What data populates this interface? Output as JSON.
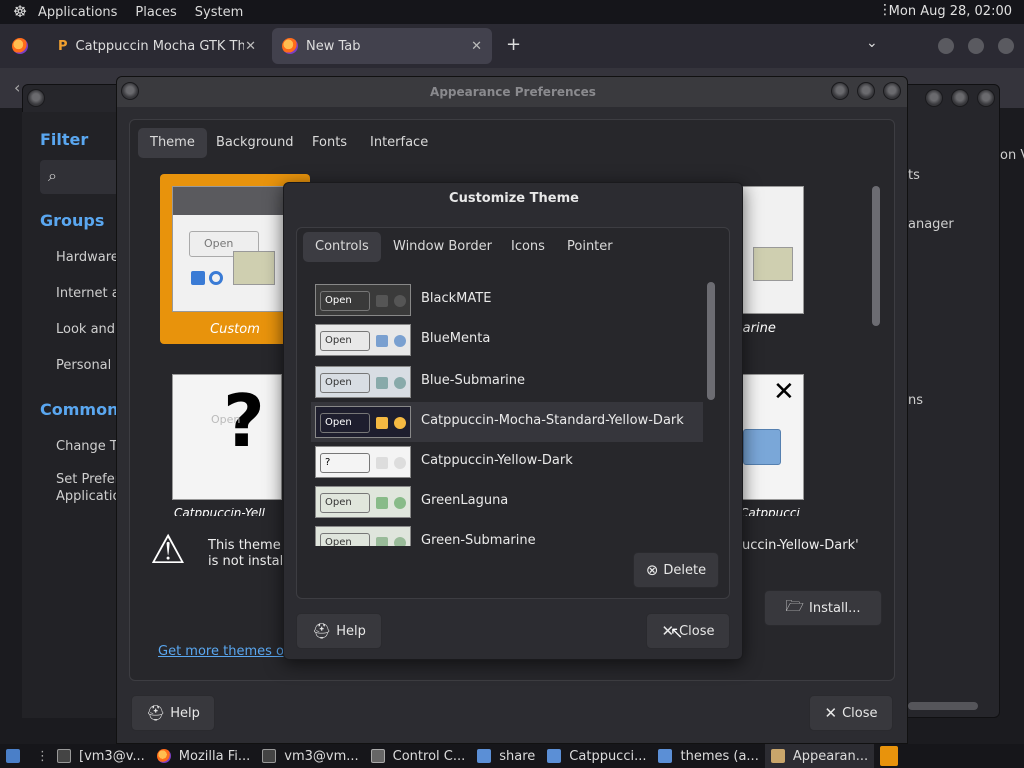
{
  "top_panel": {
    "menus": [
      "Applications",
      "Places",
      "System"
    ],
    "clock": "Mon Aug 28, 02:00"
  },
  "browser": {
    "tabs": [
      {
        "label": "Catppuccin Mocha GTK The"
      },
      {
        "label": "New Tab"
      }
    ],
    "new_tab": "+"
  },
  "control_center": {
    "filter": "Filter",
    "groups": "Groups",
    "group_items": [
      "Hardware",
      "Internet a",
      "Look and",
      "Personal"
    ],
    "common": "Common T",
    "common_items": [
      "Change Th",
      "Set Prefer",
      "Applicatio"
    ],
    "right_items": [
      "ts",
      "anager",
      "ns",
      "on Vi"
    ]
  },
  "appearance": {
    "title": "Appearance Preferences",
    "tabs": [
      "Theme",
      "Background",
      "Fonts",
      "Interface"
    ],
    "themes": [
      {
        "label": "Custom"
      },
      {
        "label": "marine"
      }
    ],
    "bottom_card_labels": [
      "Catppuccin-Yell",
      "Catppucci"
    ],
    "open_label": "Open",
    "warning_text_1": "This theme w",
    "warning_text_2": "is not installe",
    "warning_text_right": "uccin-Yellow-Dark'",
    "link": "Get more themes on",
    "install_button": "Install...",
    "help_button": "Help",
    "close_button": "Close"
  },
  "customize": {
    "title": "Customize Theme",
    "tabs": [
      "Controls",
      "Window Border",
      "Icons",
      "Pointer"
    ],
    "themes": [
      {
        "name": "BlackMATE",
        "open": "Open",
        "bg": "#3a3a3a",
        "check": "#555",
        "radio": "#555",
        "fg": "#ffffff"
      },
      {
        "name": "BlueMenta",
        "open": "Open",
        "bg": "#e8e8e8",
        "check": "#7aa0d0",
        "radio": "#7aa0d0",
        "fg": "#333333"
      },
      {
        "name": "Blue-Submarine",
        "open": "Open",
        "bg": "#d8dde3",
        "check": "#8aa",
        "radio": "#8aa",
        "fg": "#333333"
      },
      {
        "name": "Catppuccin-Mocha-Standard-Yellow-Dark",
        "open": "Open",
        "bg": "#1e1e2e",
        "check": "#f5b942",
        "radio": "#f5b942",
        "fg": "#ffffff"
      },
      {
        "name": "Catppuccin-Yellow-Dark",
        "open": "?",
        "bg": "#f4f4f4",
        "check": "#ddd",
        "radio": "#ddd",
        "fg": "#000000"
      },
      {
        "name": "GreenLaguna",
        "open": "Open",
        "bg": "#e0e6dc",
        "check": "#8b8",
        "radio": "#8b8",
        "fg": "#333333"
      },
      {
        "name": "Green-Submarine",
        "open": "Open",
        "bg": "#dfe5dc",
        "check": "#9b9",
        "radio": "#9b9",
        "fg": "#333333"
      }
    ],
    "delete_button": "Delete",
    "help_button": "Help",
    "close_button": "Close"
  },
  "taskbar": {
    "items": [
      {
        "label": "[vm3@v..."
      },
      {
        "label": "Mozilla Fi..."
      },
      {
        "label": "vm3@vm..."
      },
      {
        "label": "Control C..."
      },
      {
        "label": "share"
      },
      {
        "label": "Catppucci..."
      },
      {
        "label": "themes (a..."
      },
      {
        "label": "Appearan..."
      }
    ]
  },
  "colors": {
    "accent": "#5aa7f0",
    "selection_orange": "#e8930c"
  }
}
